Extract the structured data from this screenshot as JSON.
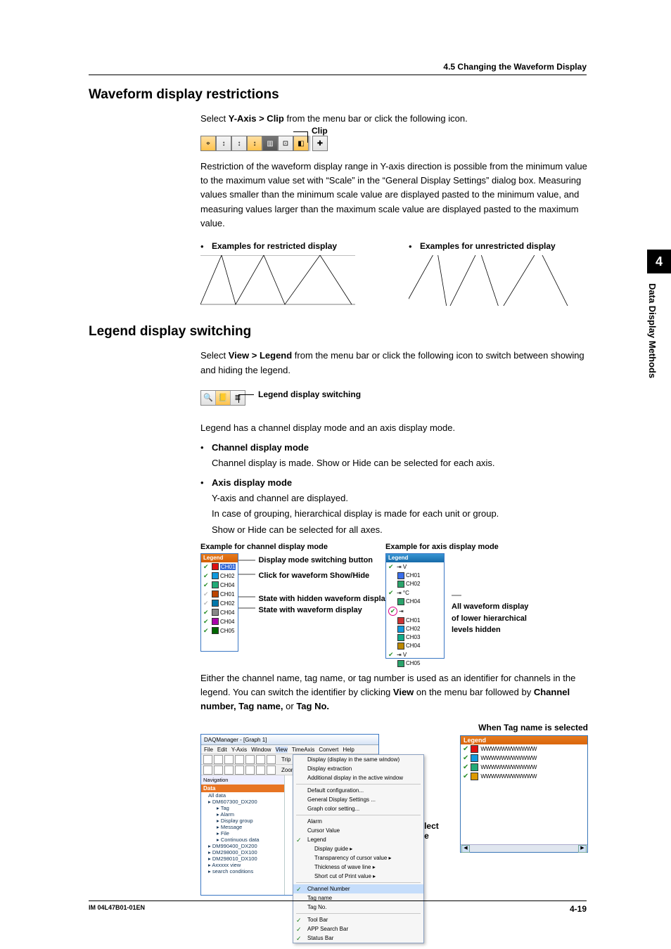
{
  "header": {
    "section": "4.5  Changing the Waveform Display"
  },
  "sideTab": {
    "num": "4",
    "label": "Data Display Methods"
  },
  "waveform": {
    "title": "Waveform display restrictions",
    "lead_pre": "Select ",
    "lead_strong": "Y-Axis > Clip",
    "lead_post": " from the menu bar or click the following icon.",
    "clip_label": "Clip",
    "para": "Restriction of the waveform display range in Y-axis direction is possible from the minimum value to the maximum value set with “Scale” in the “General Display Settings” dialog box. Measuring values smaller than the minimum scale value are displayed pasted to the minimum value, and measuring values larger than the maximum scale value are displayed pasted to the maximum value.",
    "ex_restricted": "Examples for restricted display",
    "ex_unrestricted": "Examples for unrestricted display"
  },
  "toolbar_icons": {
    "t1": "⌖",
    "t2": "↕",
    "t3": "↕",
    "t4": "↕",
    "t5": "▥",
    "t6": "⊡",
    "t7": "◧",
    "t8": "✚"
  },
  "legend": {
    "title": "Legend display switching",
    "lead_pre": "Select ",
    "lead_strong": "View > Legend",
    "lead_post": " from the menu bar or click the following icon to switch between showing and hiding the legend.",
    "switch_label": "Legend display switching",
    "line_hasmodes": "Legend has a channel display mode and an axis display mode.",
    "ch_mode_title": "Channel display mode",
    "ch_mode_body": "Channel display is made. Show or Hide can be selected for each axis.",
    "ax_mode_title": "Axis display mode",
    "ax_mode_body1": "Y-axis and channel are displayed.",
    "ax_mode_body2": "In case of grouping, hierarchical display is made for each unit or group.",
    "ax_mode_body3": "Show or Hide can be selected for all axes.",
    "tb2_icons": {
      "a": "🔍",
      "b": "📒",
      "c": "≣"
    },
    "ex_ch_title": "Example for channel display mode",
    "ex_ax_title": "Example for axis display mode",
    "callout_switch": "Display mode switching button",
    "callout_click": "Click for waveform Show/Hide",
    "callout_hidden": "State with hidden waveform display",
    "callout_shown": "State with waveform display",
    "callout_lower": "All waveform display of lower hierarchical levels hidden",
    "legend_hdr": "Legend",
    "ch_panel": [
      {
        "on": true,
        "color": "#d11",
        "name": "CH01",
        "hi": true
      },
      {
        "on": true,
        "color": "#19d",
        "name": "CH02"
      },
      {
        "on": true,
        "color": "#2a7",
        "name": "CH04"
      },
      {
        "on": false,
        "color": "#b40",
        "name": "CH01"
      },
      {
        "on": false,
        "color": "#07a",
        "name": "CH02"
      },
      {
        "on": true,
        "color": "#888",
        "name": "CH04"
      },
      {
        "on": true,
        "color": "#a0a",
        "name": "CH04"
      },
      {
        "on": true,
        "color": "#060",
        "name": "CH05"
      }
    ],
    "ax_panel": {
      "groups": [
        {
          "unit": "V",
          "items": [
            {
              "on": true,
              "color": "#3a6eea",
              "name": "CH01"
            },
            {
              "on": true,
              "color": "#2aa36b",
              "name": "CH02"
            }
          ]
        },
        {
          "unit": "°C",
          "items": [
            {
              "on": true,
              "color": "#2aa36b",
              "name": "CH04"
            }
          ]
        },
        {
          "unit": "",
          "circled": true,
          "items": [
            {
              "on": false,
              "color": "#c33",
              "name": "CH01"
            },
            {
              "on": false,
              "color": "#19d",
              "name": "CH02"
            },
            {
              "on": false,
              "color": "#1a8",
              "name": "CH03"
            },
            {
              "on": false,
              "color": "#b80",
              "name": "CH04"
            }
          ]
        },
        {
          "unit": "V",
          "items": [
            {
              "on": true,
              "color": "#2aa36b",
              "name": "CH05"
            }
          ]
        }
      ]
    },
    "para2_a": "Either the channel name, tag name, or tag number is used as an identifier for channels in the legend. You can switch the identifier by clicking ",
    "para2_b": "View",
    "para2_c": " on the menu bar followed by ",
    "para2_d": "Channel number, Tag name,",
    "para2_e": " or ",
    "para2_f": "Tag No."
  },
  "daq": {
    "title": "DAQManager - [Graph 1]",
    "menu": [
      "File",
      "Edit",
      "Y-Axis",
      "Window",
      "View",
      "TimeAxis",
      "Convert",
      "Help"
    ],
    "top_items": {
      "item1": "Trip",
      "item2": "Zoom"
    },
    "tree_hdr": "Data",
    "tree": [
      "All data",
      "DM607300_DX200",
      "Tag",
      "Alarm",
      "Display group",
      "Message",
      "File",
      "Continuous data",
      "DM990400_DX200",
      "DM298000_DX100",
      "DM298010_DX100",
      "Axxxxx view",
      "search conditions"
    ],
    "menu_open": [
      {
        "t": "Display (display in the same window)"
      },
      {
        "t": "Display extraction"
      },
      {
        "t": "Additional display in the active window"
      },
      {
        "sep": true
      },
      {
        "t": "Default configuration..."
      },
      {
        "t": "General Display Settings ..."
      },
      {
        "t": "Graph color setting..."
      },
      {
        "sep": true
      },
      {
        "t": "Alarm"
      },
      {
        "t": "Cursor Value"
      },
      {
        "t": "Legend",
        "chk": true
      },
      {
        "t": "Display guide",
        "sub": true
      },
      {
        "t": "Transparency of cursor value",
        "sub": true
      },
      {
        "t": "Thickness of wave line",
        "sub": true
      },
      {
        "t": "Short cut of Print value",
        "sub": true
      },
      {
        "sep": true
      },
      {
        "t": "Channel Number",
        "chk": true,
        "hi": true
      },
      {
        "t": "Tag name"
      },
      {
        "t": "Tag No."
      },
      {
        "sep": true
      },
      {
        "t": "Tool Bar",
        "chk": true
      },
      {
        "t": "APP Search Bar",
        "chk": true
      },
      {
        "t": "Status Bar",
        "chk": true
      }
    ],
    "callout": "Select one",
    "tag_legend_title": "When Tag name is selected",
    "tag_legend_hdr": "Legend",
    "tag_rows": [
      {
        "color": "#d11",
        "txt": "WWWWWWWWWWW"
      },
      {
        "color": "#19d",
        "txt": "WWWWWWWWWWW"
      },
      {
        "color": "#2a7",
        "txt": "WWWWWWWWWWW"
      },
      {
        "color": "#d90",
        "txt": "WWWWWWWWWWW"
      }
    ]
  },
  "footer": {
    "left": "IM 04L47B01-01EN",
    "right": "4-19"
  }
}
